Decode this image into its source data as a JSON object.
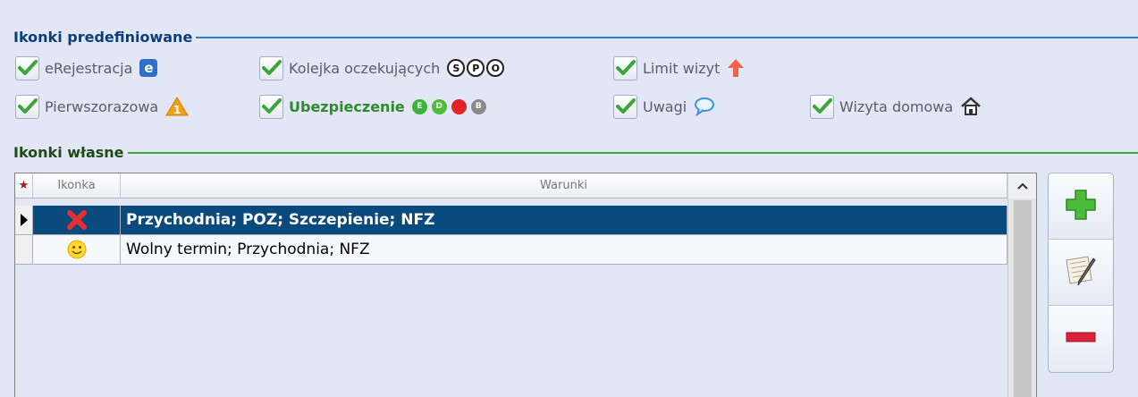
{
  "predefined": {
    "title": "Ikonki predefiniowane",
    "items": [
      {
        "label": "eRejestracja",
        "checked": true
      },
      {
        "label": "Kolejka oczekujących",
        "checked": true,
        "letters": [
          "S",
          "P",
          "O"
        ]
      },
      {
        "label": "Limit wizyt",
        "checked": true
      },
      {
        "label": "Pierwszorazowa",
        "checked": true
      },
      {
        "label": "Ubezpieczenie",
        "checked": true,
        "letters": [
          "E",
          "D",
          "",
          "B"
        ]
      },
      {
        "label": "Uwagi",
        "checked": true
      },
      {
        "label": "Wizyta domowa",
        "checked": true
      }
    ]
  },
  "custom": {
    "title": "Ikonki własne",
    "columns": {
      "star": "★",
      "icon": "Ikonka",
      "conditions": "Warunki"
    },
    "rows": [
      {
        "icon": "red-x-icon",
        "conditions": "Przychodnia; POZ; Szczepienie; NFZ",
        "selected": true
      },
      {
        "icon": "smiley-icon",
        "conditions": "Wolny termin; Przychodnia; NFZ",
        "selected": false
      }
    ]
  },
  "buttons": {
    "add": "add-icon",
    "edit": "edit-icon",
    "remove": "remove-icon"
  },
  "colors": {
    "selected_row": "#0a4a7c",
    "accent_green": "#2e8a2e",
    "header_blue": "#0b3e7a"
  }
}
